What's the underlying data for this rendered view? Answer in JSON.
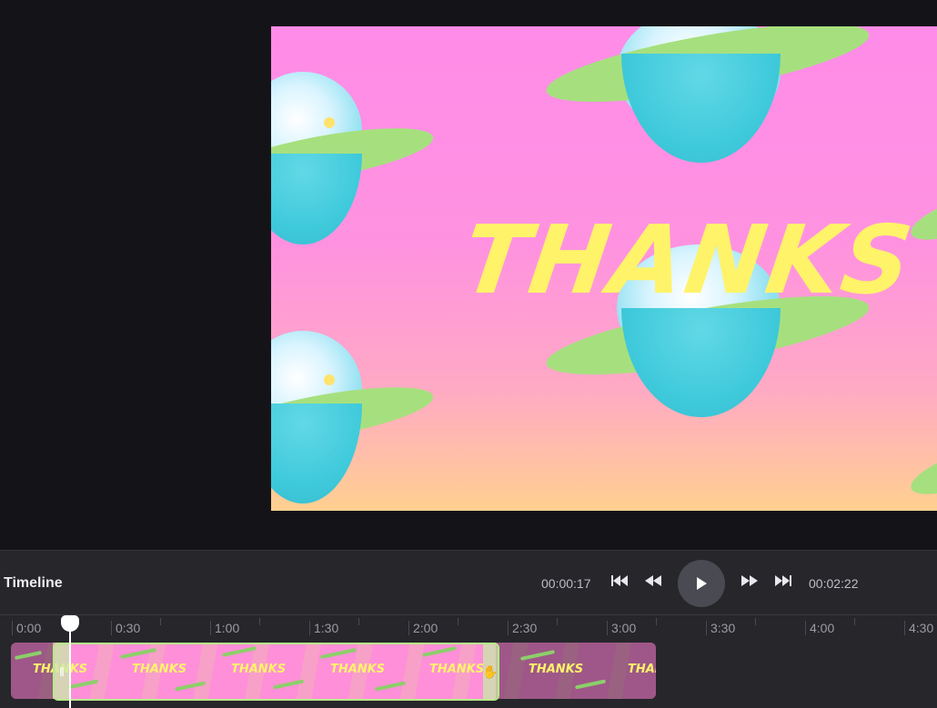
{
  "preview": {
    "title_text": "THANKS"
  },
  "timeline": {
    "label": "Timeline",
    "current_time": "00:00:17",
    "total_time": "00:02:22",
    "controls": {
      "skip_start_icon": "skip-to-start-icon",
      "rewind_icon": "rewind-icon",
      "play_icon": "play-icon",
      "fast_forward_icon": "fast-forward-icon",
      "skip_end_icon": "skip-to-end-icon"
    },
    "ruler_labels": [
      "0:00",
      "0:30",
      "1:00",
      "1:30",
      "2:00",
      "2:30",
      "3:00",
      "3:30",
      "4:00",
      "4:30"
    ],
    "clip_text": "THANKS",
    "colors": {
      "selection_border": "#b7ea8a",
      "text_accent": "#fff36a",
      "preview_pink": "#ff8ce8"
    }
  }
}
